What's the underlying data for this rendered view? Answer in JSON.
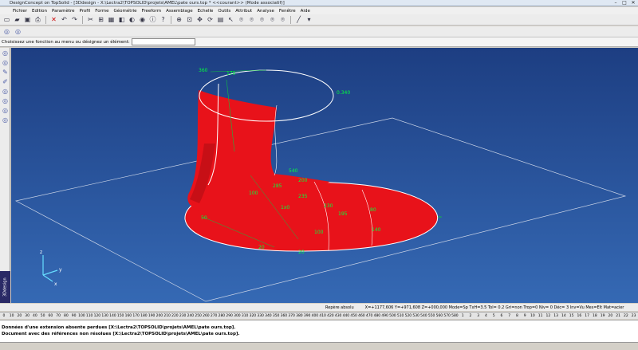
{
  "window": {
    "title": "DesignConcept on TopSolid - [3Ddesign - X:\\Lectra2\\TOPSOLID\\projets\\AMEL\\pate ours.top * <<courant>> (Mode associatif)]"
  },
  "menu": [
    "Fichier",
    "Edition",
    "Paramètre",
    "Profil",
    "Forme",
    "Géométrie",
    "Freeform",
    "Assemblage",
    "Echelle",
    "Outils",
    "Attribut",
    "Analyse",
    "Fenêtre",
    "Aide"
  ],
  "command_prompt": "Choisissez une fonction au menu ou désignez un élément:",
  "viewport": {
    "side_tab_label": "3Ddesign",
    "labels": [
      "360",
      "170",
      "0.340",
      "540",
      "200",
      "285",
      "100",
      "235",
      "1x0",
      "230",
      "195",
      "80",
      "50",
      "100",
      "140",
      "20",
      "20"
    ],
    "axis": {
      "x": "x",
      "y": "y",
      "z": "z"
    },
    "colors": {
      "background_top": "#1d3e82",
      "background_bottom": "#3569b4",
      "surface": "#e8121a",
      "edge": "#ffffff",
      "dimension": "#00ff3c"
    }
  },
  "status": {
    "mode": "Repère absolu",
    "coords": "X=+1177,606  Y=+971,608  Z=+000,000  Mode=Sp  TxH=3.5  Tol= 0.2  Gri=non  Trop=0  Niv= 0  Déc= 3  Inv=Vu  Mes=Elt  Mat=acier"
  },
  "ruler": [
    "0",
    "10",
    "20",
    "30",
    "40",
    "50",
    "60",
    "70",
    "80",
    "90",
    "100",
    "110",
    "120",
    "130",
    "140",
    "150",
    "160",
    "170",
    "180",
    "190",
    "200",
    "210",
    "220",
    "230",
    "240",
    "250",
    "260",
    "270",
    "280",
    "290",
    "300",
    "310",
    "320",
    "330",
    "340",
    "350",
    "360",
    "370",
    "380",
    "390",
    "400",
    "410",
    "420",
    "430",
    "440",
    "450",
    "460",
    "470",
    "480",
    "490",
    "500",
    "510",
    "520",
    "530",
    "540",
    "550",
    "560",
    "570",
    "580",
    "1",
    "2",
    "3",
    "4",
    "5",
    "6",
    "7",
    "8",
    "9",
    "10",
    "11",
    "12",
    "13",
    "14",
    "15",
    "16",
    "17",
    "18",
    "19",
    "20",
    "21",
    "22",
    "23"
  ],
  "messages": [
    "Données d'une extension absente perdues [X:\\Lectra2\\TOPSOLID\\projets\\AMEL\\pate ours.top].",
    "Document avec des références non résolues [X:\\Lectra2\\TOPSOLID\\projets\\AMEL\\pate ours.top]."
  ]
}
